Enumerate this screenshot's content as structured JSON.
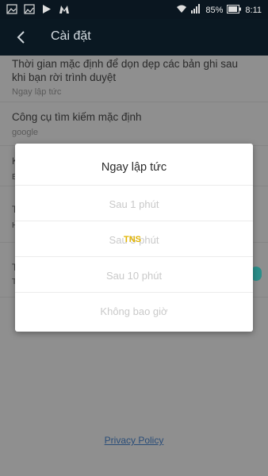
{
  "status_bar": {
    "battery": "85%",
    "time": "8:11"
  },
  "app_bar": {
    "title": "Cài đặt"
  },
  "settings": {
    "clear_history": {
      "title": "Thời gian mặc định để dọn dẹp các bản ghi sau khi bạn rời trình duyệt",
      "value": "Ngay lập tức"
    },
    "search_engine": {
      "title": "Công cụ tìm kiếm mặc định",
      "value": "google"
    },
    "row3": {
      "title_initial": "K",
      "sub_initial": "B"
    },
    "row4": {
      "title_initial": "T",
      "sub_initial": "H"
    },
    "row5": {
      "title_initial": "T",
      "sub_initial": "T"
    }
  },
  "privacy_policy": "Privacy Policy",
  "dialog": {
    "title": "Ngay lập tức",
    "options": [
      "Sau 1 phút",
      "Sau 5 phút",
      "Sau 10 phút",
      "Không bao giờ"
    ],
    "watermark": "TNS"
  },
  "colors": {
    "toggle_accent": "#2b8f8a",
    "app_bar": "#0a1822"
  }
}
